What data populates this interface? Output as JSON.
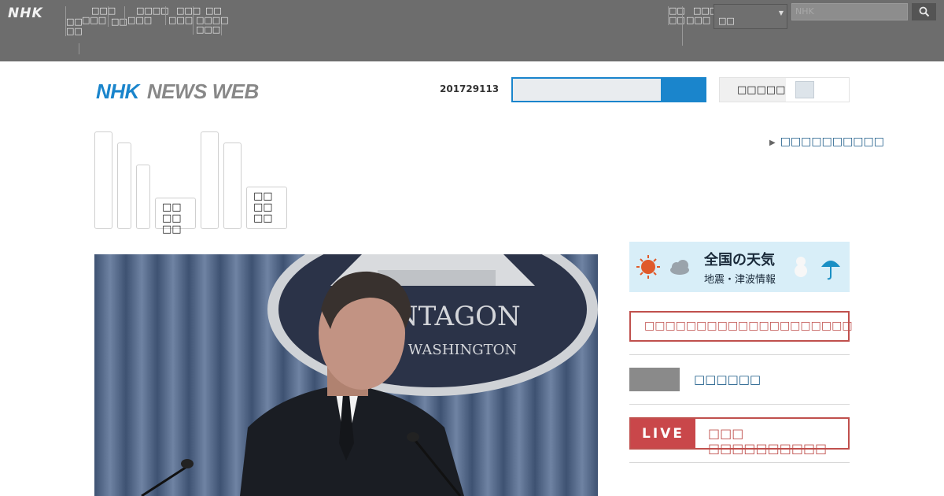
{
  "topbar": {
    "logo": "NHK",
    "nav": [
      [
        "□□",
        "□□"
      ],
      [
        "□□□",
        "□□□"
      ],
      [
        "□□"
      ],
      [
        "□□□□",
        "□□□"
      ],
      [
        "□□□",
        "□□□"
      ],
      [
        "□□",
        "□□□□",
        "□□□"
      ]
    ],
    "region_nav": [
      [
        "□□",
        "□□"
      ],
      [
        "□□□",
        "□□□"
      ]
    ],
    "region_select": "□□",
    "search_placeholder": "NHK"
  },
  "header": {
    "logo_nhk": "NHK",
    "logo_news": "NEWS WEB",
    "date": "201729113",
    "settings_label": "□□□□□"
  },
  "right_link": "□□□□□□□□□□",
  "categories": [
    "□□□□□□",
    "□□□□",
    "□□□",
    "□□□□□□",
    "□□□□",
    "□□□□",
    "□□□",
    "□□□□□"
  ],
  "hero": {
    "seal_text": "PENTAGON",
    "seal_sub": "WASHINGTON"
  },
  "sidebar": {
    "weather_title": "全国の天気",
    "weather_sub": "地震・津波情報",
    "alert": "□□□□□□□□□□□□□□□□□□□□",
    "link": "□□□□□□",
    "live_badge": "LIVE",
    "live_text": "□□□ □□□□□□□□□□"
  },
  "colors": {
    "brand_blue": "#1a85cc",
    "alert_red": "#c0504d",
    "topbar": "#6d6d6d"
  }
}
